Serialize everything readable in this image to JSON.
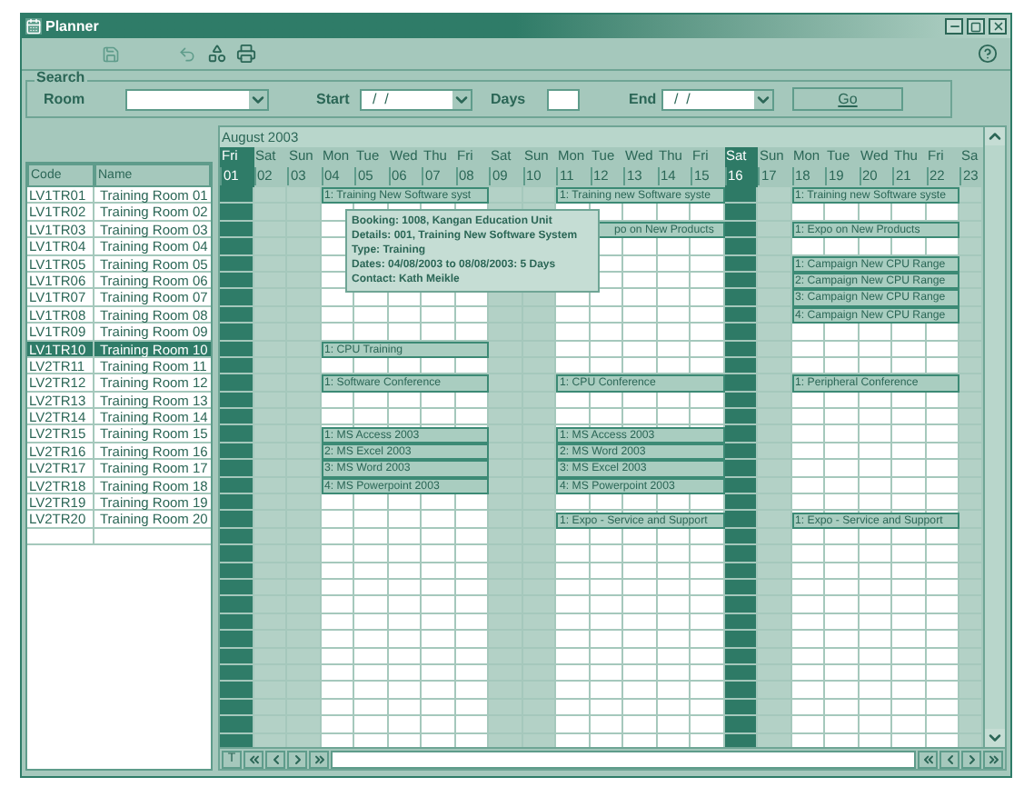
{
  "window": {
    "title": "Planner"
  },
  "search": {
    "legend": "Search",
    "room_label": "Room",
    "start_label": "Start",
    "start_value": "/  /",
    "days_label": "Days",
    "end_label": "End",
    "end_value": "/  /",
    "go_label": "Go"
  },
  "list": {
    "columns": [
      "Code",
      "Name"
    ]
  },
  "grid": {
    "month": "August 2003",
    "nav_label": "T"
  },
  "days": [
    {
      "name": "Fri",
      "number": "01",
      "kind": "weekday",
      "selected": true
    },
    {
      "name": "Sat",
      "number": "02",
      "kind": "weekend",
      "selected": false
    },
    {
      "name": "Sun",
      "number": "03",
      "kind": "weekend",
      "selected": false
    },
    {
      "name": "Mon",
      "number": "04",
      "kind": "weekday",
      "selected": false
    },
    {
      "name": "Tue",
      "number": "05",
      "kind": "weekday",
      "selected": false
    },
    {
      "name": "Wed",
      "number": "06",
      "kind": "weekday",
      "selected": false
    },
    {
      "name": "Thu",
      "number": "07",
      "kind": "weekday",
      "selected": false
    },
    {
      "name": "Fri",
      "number": "08",
      "kind": "weekday",
      "selected": false
    },
    {
      "name": "Sat",
      "number": "09",
      "kind": "weekend",
      "selected": false
    },
    {
      "name": "Sun",
      "number": "10",
      "kind": "weekend",
      "selected": false
    },
    {
      "name": "Mon",
      "number": "11",
      "kind": "weekday",
      "selected": false
    },
    {
      "name": "Tue",
      "number": "12",
      "kind": "weekday",
      "selected": false
    },
    {
      "name": "Wed",
      "number": "13",
      "kind": "weekday",
      "selected": false
    },
    {
      "name": "Thu",
      "number": "14",
      "kind": "weekday",
      "selected": false
    },
    {
      "name": "Fri",
      "number": "15",
      "kind": "weekday",
      "selected": false
    },
    {
      "name": "Sat",
      "number": "16",
      "kind": "weekend",
      "selected": true
    },
    {
      "name": "Sun",
      "number": "17",
      "kind": "weekend",
      "selected": false
    },
    {
      "name": "Mon",
      "number": "18",
      "kind": "weekday",
      "selected": false
    },
    {
      "name": "Tue",
      "number": "19",
      "kind": "weekday",
      "selected": false
    },
    {
      "name": "Wed",
      "number": "20",
      "kind": "weekday",
      "selected": false
    },
    {
      "name": "Thu",
      "number": "21",
      "kind": "weekday",
      "selected": false
    },
    {
      "name": "Fri",
      "number": "22",
      "kind": "weekday",
      "selected": false
    },
    {
      "name": "Sa",
      "number": "23",
      "kind": "weekend",
      "selected": false
    }
  ],
  "rooms": [
    {
      "code": "LV1TR01",
      "name": "Training Room 01",
      "selected": false,
      "weeks": [
        {
          "kind": "booking",
          "text": "1: Training New Software syst",
          "tooltip": {
            "lines": [
              "Booking: 1008, Kangan Education Unit",
              "Details: 001, Training New Software System",
              "Type: Training",
              "Dates: 04/08/2003 to 08/08/2003: 5 Days",
              "Contact: Kath Meikle"
            ]
          }
        },
        {
          "kind": "booking",
          "text": "1: Training new Software syste"
        },
        {
          "kind": "booking",
          "text": "1: Training new Software syste"
        }
      ]
    },
    {
      "code": "LV1TR02",
      "name": "Training Room 02",
      "selected": false
    },
    {
      "code": "LV1TR03",
      "name": "Training Room 03",
      "selected": false,
      "weeks": [
        {
          "kind": "free"
        },
        {
          "kind": "booking",
          "text": "po on New Products",
          "hidden_start": true
        },
        {
          "kind": "booking",
          "text": "1: Expo on New Products"
        }
      ]
    },
    {
      "code": "LV1TR04",
      "name": "Training Room 04",
      "selected": false
    },
    {
      "code": "LV1TR05",
      "name": "Training Room 05",
      "selected": false,
      "weeks": [
        {
          "kind": "free"
        },
        {
          "kind": "free"
        },
        {
          "kind": "booking",
          "text": "1: Campaign New CPU Range"
        }
      ]
    },
    {
      "code": "LV1TR06",
      "name": "Training Room 06",
      "selected": false,
      "weeks": [
        {
          "kind": "free"
        },
        {
          "kind": "free"
        },
        {
          "kind": "booking",
          "text": "2: Campaign New CPU Range"
        }
      ]
    },
    {
      "code": "LV1TR07",
      "name": "Training Room 07",
      "selected": false,
      "weeks": [
        {
          "kind": "free"
        },
        {
          "kind": "free"
        },
        {
          "kind": "booking",
          "text": "3: Campaign New CPU Range"
        }
      ]
    },
    {
      "code": "LV1TR08",
      "name": "Training Room 08",
      "selected": false,
      "weeks": [
        {
          "kind": "free"
        },
        {
          "kind": "free"
        },
        {
          "kind": "booking",
          "text": "4: Campaign New CPU Range"
        }
      ]
    },
    {
      "code": "LV1TR09",
      "name": "Training Room 09",
      "selected": false
    },
    {
      "code": "LV1TR10",
      "name": "Training Room 10",
      "selected": true,
      "weeks": [
        {
          "kind": "booking",
          "text": "1: CPU Training"
        }
      ]
    },
    {
      "code": "LV2TR11",
      "name": "Training Room 11",
      "selected": false
    },
    {
      "code": "LV2TR12",
      "name": "Training Room 12",
      "selected": false,
      "weeks": [
        {
          "kind": "booking",
          "text": "1: Software Conference"
        },
        {
          "kind": "booking",
          "text": "1: CPU Conference"
        },
        {
          "kind": "booking",
          "text": "1: Peripheral Conference"
        }
      ]
    },
    {
      "code": "LV2TR13",
      "name": "Training Room 13",
      "selected": false
    },
    {
      "code": "LV2TR14",
      "name": "Training Room 14",
      "selected": false
    },
    {
      "code": "LV2TR15",
      "name": "Training Room 15",
      "selected": false,
      "weeks": [
        {
          "kind": "booking",
          "text": "1: MS Access 2003"
        },
        {
          "kind": "booking",
          "text": "1: MS Access 2003"
        }
      ]
    },
    {
      "code": "LV2TR16",
      "name": "Training Room 16",
      "selected": false,
      "weeks": [
        {
          "kind": "booking",
          "text": "2: MS Excel 2003"
        },
        {
          "kind": "booking",
          "text": "2: MS Word 2003"
        }
      ]
    },
    {
      "code": "LV2TR17",
      "name": "Training Room 17",
      "selected": false,
      "weeks": [
        {
          "kind": "booking",
          "text": "3: MS Word 2003"
        },
        {
          "kind": "booking",
          "text": "3: MS Excel 2003"
        }
      ]
    },
    {
      "code": "LV2TR18",
      "name": "Training Room 18",
      "selected": false,
      "weeks": [
        {
          "kind": "booking",
          "text": "4: MS Powerpoint 2003"
        },
        {
          "kind": "booking",
          "text": "4: MS Powerpoint 2003"
        }
      ]
    },
    {
      "code": "LV2TR19",
      "name": "Training Room 19",
      "selected": false
    },
    {
      "code": "LV2TR20",
      "name": "Training Room 20",
      "selected": false,
      "weeks": [
        {
          "kind": "free"
        },
        {
          "kind": "booking",
          "text": "1: Expo - Service and Support"
        },
        {
          "kind": "booking",
          "text": "1: Expo - Service and Support"
        }
      ]
    }
  ]
}
